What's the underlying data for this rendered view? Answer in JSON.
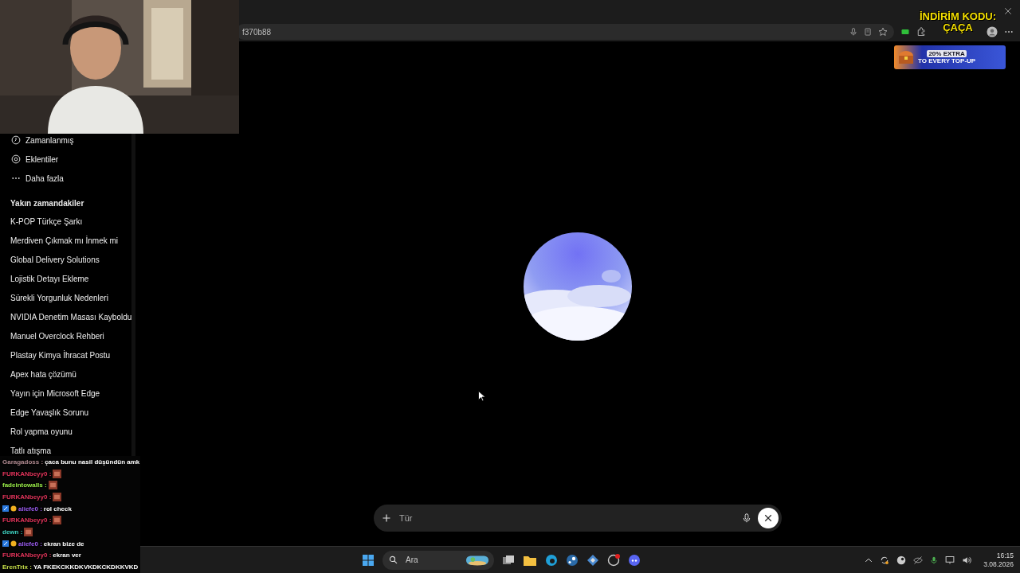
{
  "browser": {
    "address": "f370b88"
  },
  "sidebar": {
    "items": [
      {
        "kind": "clock",
        "label": "Zamanlanmış"
      },
      {
        "kind": "at",
        "label": "Eklentiler"
      },
      {
        "kind": "more",
        "label": "Daha fazla"
      }
    ],
    "section_title": "Yakın zamandakiler",
    "history": [
      "K-POP Türkçe Şarkı",
      "Merdiven Çıkmak mı İnmek mi",
      "Global Delivery Solutions",
      "Lojistik Detayı Ekleme",
      "Sürekli Yorgunluk Nedenleri",
      "NVIDIA Denetim Masası Kayboldu",
      "Manuel Overclock Rehberi",
      "Plastay Kimya İhracat Postu",
      "Apex hata çözümü",
      "Yayın için Microsoft Edge",
      "Edge Yavaşlık Sorunu",
      "Rol yapma oyunu",
      "Tatlı atışma"
    ]
  },
  "composer": {
    "placeholder": "Tür"
  },
  "promo": {
    "code_label": "İNDİRİM KODU:",
    "code": "ÇAÇA",
    "banner_line_1": "20% EXTRA",
    "banner_line_2": "TO EVERY TOP-UP"
  },
  "chat": [
    {
      "user": "Garagadoss :",
      "color": "#b08a90",
      "badges": false,
      "emote": false,
      "text": "çaca bunu nasil düşündün amk"
    },
    {
      "user": "FURKANbeyy0 :",
      "color": "#e0345a",
      "badges": false,
      "emote": true
    },
    {
      "user": "fadeintowalls :",
      "color": "#9bee4a",
      "badges": false,
      "emote": true
    },
    {
      "user": "FURKANbeyy0 :",
      "color": "#e0345a",
      "badges": false,
      "emote": true
    },
    {
      "user": "aliefe0 :",
      "color": "#9b5cf0",
      "badges": true,
      "emote": false,
      "text": "rol check"
    },
    {
      "user": "FURKANbeyy0 :",
      "color": "#e0345a",
      "badges": false,
      "emote": true
    },
    {
      "user": "dewn :",
      "color": "#3fd0c0",
      "badges": false,
      "emote": true
    },
    {
      "user": "aliefe0 :",
      "color": "#9b5cf0",
      "badges": true,
      "emote": false,
      "text": "ekran bize de"
    },
    {
      "user": "FURKANbeyy0 :",
      "color": "#e0345a",
      "badges": false,
      "emote": false,
      "text": "ekran ver"
    },
    {
      "user": "ErenTrix :",
      "color": "#c8e04a",
      "badges": false,
      "emote": false,
      "text": "YA FKEKCKKDKVKDKCKDKKVKD"
    }
  ],
  "taskbar": {
    "search_placeholder": "Ara",
    "time": "16:15",
    "date": "3.08.2026"
  }
}
